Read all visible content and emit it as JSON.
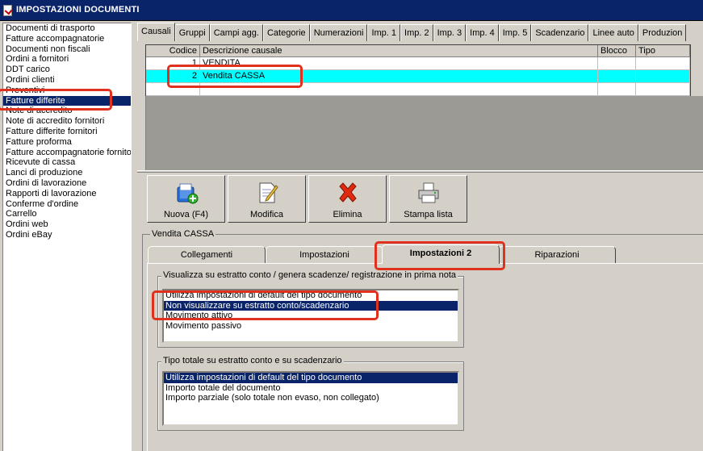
{
  "window": {
    "title": "IMPOSTAZIONI DOCUMENTI"
  },
  "doc_types": {
    "items": [
      "Documenti di trasporto",
      "Fatture accompagnatorie",
      "Documenti non fiscali",
      "Ordini a fornitori",
      "DDT carico",
      "Ordini clienti",
      "Preventivi",
      "Fatture differite",
      "Note di accredito",
      "Note di accredito fornitori",
      "Fatture differite fornitori",
      "Fatture proforma",
      "Fatture accompagnatorie fornitori",
      "Ricevute di cassa",
      "Lanci di produzione",
      "Ordini di lavorazione",
      "Rapporti di lavorazione",
      "Conferme d'ordine",
      "Carrello",
      "Ordini web",
      "Ordini eBay"
    ],
    "selected": "Fatture differite"
  },
  "tabs": [
    "Causali",
    "Gruppi",
    "Campi agg.",
    "Categorie",
    "Numerazioni",
    "Imp. 1",
    "Imp. 2",
    "Imp. 3",
    "Imp. 4",
    "Imp. 5",
    "Scadenzario",
    "Linee auto",
    "Produzion"
  ],
  "active_tab": "Causali",
  "grid": {
    "headers": {
      "codice": "Codice",
      "descrizione": "Descrizione causale",
      "blocco": "Blocco",
      "tipo": "Tipo"
    },
    "rows": [
      {
        "codice": "1",
        "descrizione": "VENDITA",
        "blocco": "",
        "tipo": ""
      },
      {
        "codice": "2",
        "descrizione": "Vendita CASSA",
        "blocco": "",
        "tipo": ""
      },
      {
        "codice": "",
        "descrizione": "",
        "blocco": "",
        "tipo": ""
      }
    ]
  },
  "toolbar": {
    "new_label": "Nuova (F4)",
    "edit_label": "Modifica",
    "delete_label": "Elimina",
    "print_label": "Stampa lista"
  },
  "detail": {
    "title": "Vendita CASSA",
    "subtabs": [
      "Collegamenti",
      "Impostazioni",
      "Impostazioni 2",
      "Riparazioni"
    ],
    "active_subtab": "Impostazioni 2",
    "group1": {
      "title": "Visualizza su estratto conto / genera scadenze/ registrazione  in prima nota",
      "options": [
        "Utilizza impostazioni di default del tipo documento",
        "Non visualizzare su estratto conto/scadenzario",
        "Movimento attivo",
        "Movimento passivo"
      ],
      "selected": "Non visualizzare su estratto conto/scadenzario"
    },
    "group2": {
      "title": "Tipo totale su estratto conto e su scadenzario",
      "options": [
        "Utilizza impostazioni di default del tipo documento",
        "Importo totale del documento",
        "Importo parziale (solo totale non evaso, non collegato)"
      ],
      "selected": "Utilizza impostazioni di default del tipo documento"
    }
  },
  "icons": [
    "app-icon",
    "new-document-icon",
    "edit-document-icon",
    "delete-x-icon",
    "printer-icon"
  ],
  "colors": {
    "titlebar": "#0a246a",
    "selection": "#0a246a",
    "row_highlight": "#00ffff",
    "annotation": "#e0301e",
    "panel": "#d4d0c8"
  }
}
